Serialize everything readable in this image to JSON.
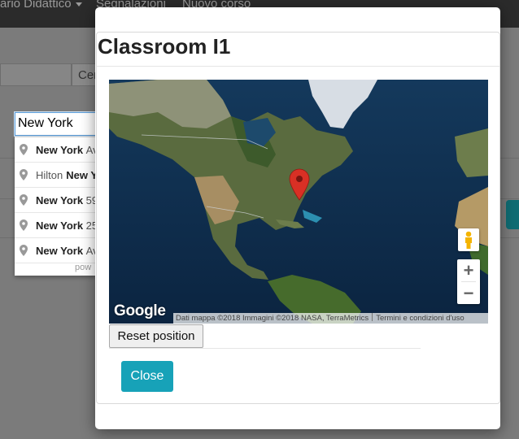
{
  "background": {
    "nav": [
      "ario Didattico",
      "Segnalazioni",
      "Nuovo corso"
    ],
    "search_button_label": "Cer"
  },
  "autocomplete": {
    "input_value": "New York",
    "suggestions": [
      {
        "prefix": "",
        "bold": "New York",
        "rest": "Av"
      },
      {
        "prefix": "Hilton",
        "bold": "New Y",
        "rest": ""
      },
      {
        "prefix": "",
        "bold": "New York",
        "rest": "59"
      },
      {
        "prefix": "",
        "bold": "New York",
        "rest": "25"
      },
      {
        "prefix": "",
        "bold": "New York",
        "rest": "Av"
      }
    ],
    "footer": "pow"
  },
  "modal": {
    "title": "Classroom I1",
    "reset_label": "Reset position",
    "close_label": "Close",
    "accent": "#17a2b8"
  },
  "map": {
    "logo": "Google",
    "attribution": "Dati mappa ©2018 Immagini ©2018 NASA, TerraMetrics",
    "terms": "Termini e condizioni d'uso",
    "zoom_in": "+",
    "zoom_out": "−",
    "marker_color": "#d93025"
  }
}
